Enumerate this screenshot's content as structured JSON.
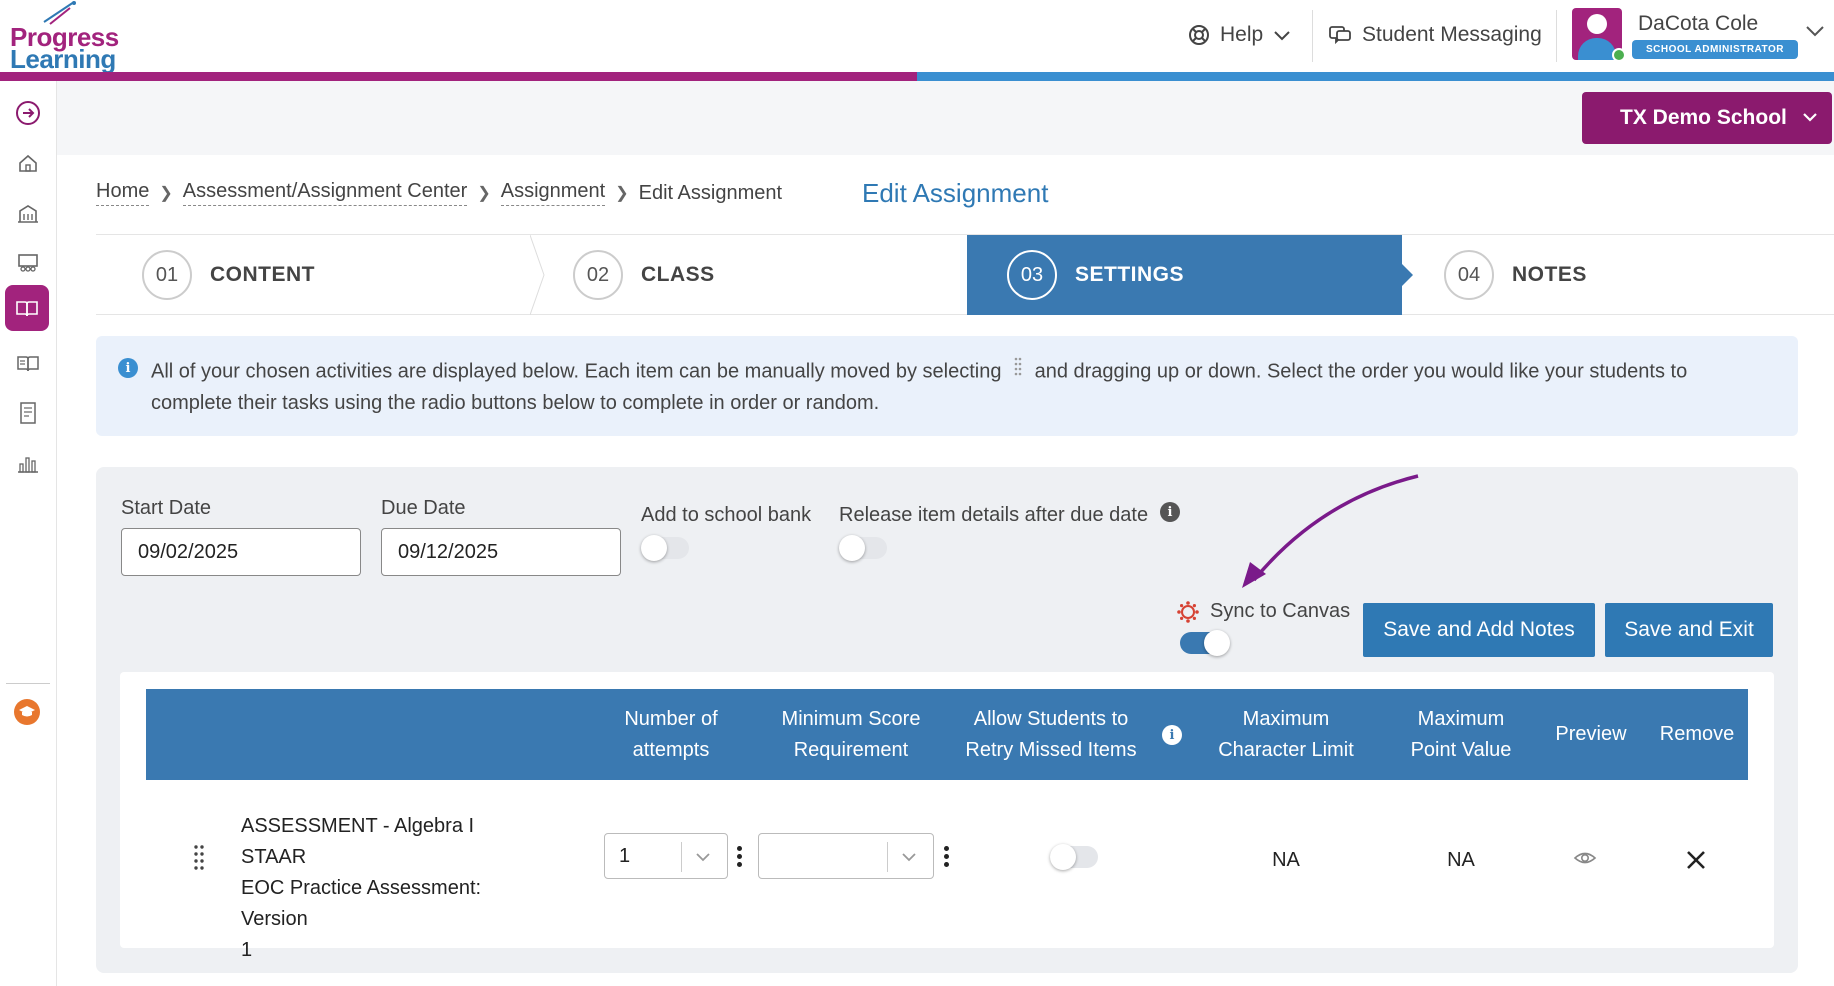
{
  "header": {
    "logo_line1": "Progress",
    "logo_line2": "Learning",
    "help_label": "Help",
    "messaging_label": "Student Messaging",
    "user_name": "DaCota Cole",
    "user_role": "SCHOOL ADMINISTRATOR",
    "school_name": "TX Demo School"
  },
  "sidebar": {
    "icons": [
      "expand-icon",
      "home-icon",
      "school-icon",
      "classroom-icon",
      "assignment-book-icon",
      "reading-icon",
      "report-icon",
      "analytics-icon",
      "graduation-cap-icon"
    ],
    "active": "assignment-book-icon"
  },
  "breadcrumb": {
    "items": [
      "Home",
      "Assessment/Assignment Center",
      "Assignment",
      "Edit Assignment"
    ]
  },
  "page_title": "Edit Assignment",
  "steps": [
    {
      "num": "01",
      "label": "CONTENT"
    },
    {
      "num": "02",
      "label": "CLASS"
    },
    {
      "num": "03",
      "label": "SETTINGS"
    },
    {
      "num": "04",
      "label": "NOTES"
    }
  ],
  "active_step": "03",
  "info_text_a": "All of your chosen activities are displayed below. Each item can be manually moved by selecting",
  "info_text_b": "and dragging up or down. Select the order you would like your students to complete their tasks using the radio buttons below to complete in order or random.",
  "settings": {
    "start_date_label": "Start Date",
    "start_date_value": "09/02/2025",
    "due_date_label": "Due Date",
    "due_date_value": "09/12/2025",
    "school_bank_label": "Add to school bank",
    "school_bank_on": false,
    "release_label": "Release item details after due date",
    "release_on": false,
    "sync_label": "Sync to Canvas",
    "sync_on": true,
    "save_notes_label": "Save and Add Notes",
    "save_exit_label": "Save and Exit"
  },
  "table": {
    "headers": {
      "attempts_a": "Number of",
      "attempts_b": "attempts",
      "minscore_a": "Minimum Score",
      "minscore_b": "Requirement",
      "retry_a": "Allow Students to",
      "retry_b": "Retry Missed Items",
      "charlimit_a": "Maximum",
      "charlimit_b": "Character Limit",
      "pointval_a": "Maximum",
      "pointval_b": "Point Value",
      "preview": "Preview",
      "remove": "Remove"
    },
    "rows": [
      {
        "name_l1": "ASSESSMENT - Algebra I STAAR",
        "name_l2": "EOC Practice Assessment: Version",
        "name_l3": "1",
        "attempts": "1",
        "min_score": "",
        "retry_on": false,
        "char_limit": "NA",
        "point_value": "NA"
      }
    ]
  },
  "colors": {
    "brand_purple": "#a2237d",
    "brand_blue": "#3a79b1",
    "button_blue": "#2f79b4",
    "annotation_arrow": "#7a1a8a"
  }
}
